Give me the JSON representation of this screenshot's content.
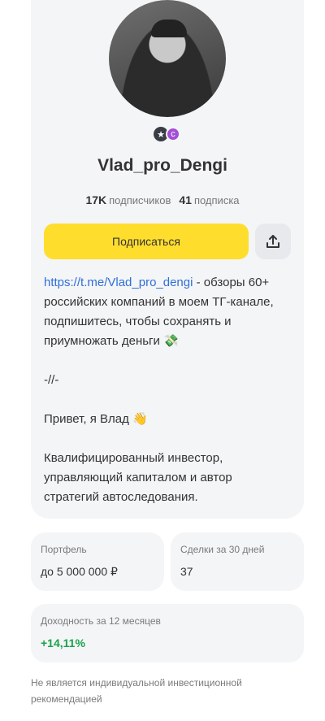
{
  "profile": {
    "name": "Vlad_pro_Dengi",
    "followers_count": "17K",
    "followers_label": "подписчиков",
    "following_count": "41",
    "following_label": "подписка",
    "badges": [
      "star-icon",
      "c-icon"
    ]
  },
  "actions": {
    "subscribe_label": "Подписаться",
    "share_icon": "share-icon"
  },
  "bio": {
    "link": "https://t.me/Vlad_pro_dengi",
    "text1": " - обзоры 60+ российских компаний в моем ТГ-канале, подпишитесь, чтобы сохранять и приумножать деньги 💸",
    "text2": "-//-",
    "text3": "Привет, я Влад 👋",
    "text4": "Квалифицированный инвестор, управляющий капиталом и автор стратегий автоследования."
  },
  "cards": {
    "portfolio_label": "Портфель",
    "portfolio_value": "до 5 000 000 ₽",
    "deals_label": "Сделки за 30 дней",
    "deals_value": "37",
    "yield_label": "Доходность за 12 месяцев",
    "yield_value": "+14,11%",
    "yield_color": "#1aa34a"
  },
  "disclaimer": "Не является индивидуальной инвестиционной рекомендацией"
}
